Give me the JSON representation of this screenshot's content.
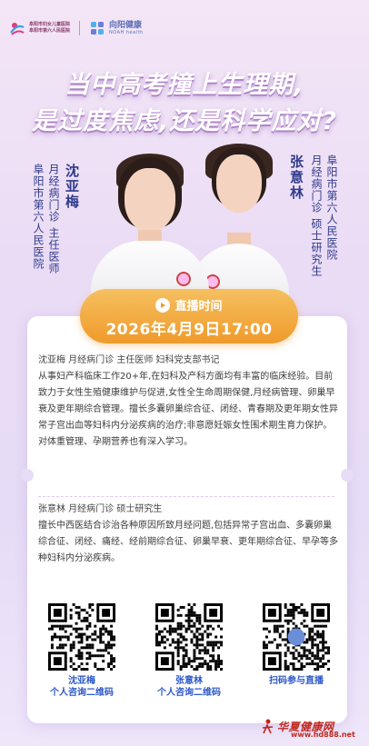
{
  "header": {
    "logo1_line1": "阜阳市妇女儿童医院",
    "logo1_line2": "阜阳市第六人民医院",
    "logo2_name": "向阳健康",
    "logo2_sub": "NOAH health"
  },
  "headline": {
    "line1": "当中高考撞上生理期,",
    "line2": "是过度焦虑,还是科学应对?"
  },
  "doctor_left": {
    "name": "沈亚梅",
    "dept_title": "月经病门诊 主任医师",
    "hospital": "阜阳市第六人民医院"
  },
  "doctor_right": {
    "name": "张意林",
    "dept_title": "月经病门诊 硕士研究生",
    "hospital": "阜阳市第六人民医院"
  },
  "live": {
    "label": "直播时间",
    "time": "2026年4月9日17:00"
  },
  "bios": [
    {
      "head": "沈亚梅 月经病门诊 主任医师 妇科党支部书记",
      "text": "从事妇产科临床工作20+年,在妇科及产科方面均有丰富的临床经验。目前致力于女性生殖健康维护与促进,女性全生命周期保健,月经病管理、卵巢早衰及更年期综合管理。擅长多囊卵巢综合征、闭经、青春期及更年期女性异常子宫出血等妇科内分泌疾病的治疗;非意愿妊娠女性围术期生育力保护。对体重管理、孕期营养也有深入学习。"
    },
    {
      "head": "张意林 月经病门诊 硕士研究生",
      "text": "擅长中西医结合诊治各种原因所致月经问题,包括异常子宫出血、多囊卵巢综合征、闭经、痛经、经前期综合征、卵巢早衰、更年期综合征、早孕等多种妇科内分泌疾病。"
    }
  ],
  "qr_codes": [
    {
      "line1": "沈亚梅",
      "line2": "个人咨询二维码"
    },
    {
      "line1": "张意林",
      "line2": "个人咨询二维码"
    },
    {
      "line1": "扫码参与直播",
      "line2": ""
    }
  ],
  "watermark": {
    "name": "华夏健康网",
    "url": "www.hd888.net"
  },
  "colors": {
    "accent_blue": "#2d58c8",
    "name_blue": "#2f3b8c",
    "live_orange": "#f09a2a"
  }
}
